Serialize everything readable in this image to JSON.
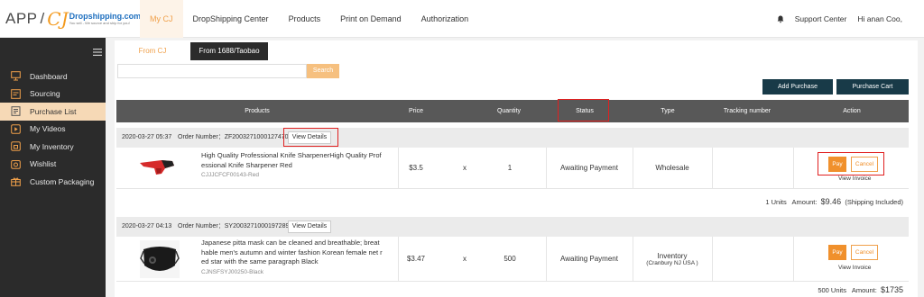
{
  "logo": {
    "app": "APP",
    "slash": "/",
    "cj": "CJ",
    "brand": "Dropshipping.com",
    "tagline": "You sell - We source and ship for you!"
  },
  "nav": {
    "items": [
      "My CJ",
      "DropShipping Center",
      "Products",
      "Print on Demand",
      "Authorization"
    ],
    "active": "My CJ"
  },
  "header_right": {
    "support": "Support Center",
    "greeting": "Hi anan Coo,"
  },
  "sidebar": {
    "items": [
      {
        "label": "Dashboard",
        "icon": "dashboard-icon"
      },
      {
        "label": "Sourcing",
        "icon": "sourcing-icon"
      },
      {
        "label": "Purchase List",
        "icon": "purchase-list-icon",
        "active": true
      },
      {
        "label": "My Videos",
        "icon": "video-icon"
      },
      {
        "label": "My Inventory",
        "icon": "inventory-icon"
      },
      {
        "label": "Wishlist",
        "icon": "wishlist-icon"
      },
      {
        "label": "Custom Packaging",
        "icon": "gift-icon"
      }
    ]
  },
  "tabs": [
    "From CJ",
    "From 1688/Taobao"
  ],
  "search": {
    "placeholder": "",
    "button": "Search"
  },
  "actions": {
    "add_purchase": "Add Purchase",
    "purchase_cart": "Purchase Cart"
  },
  "table": {
    "columns": [
      "Products",
      "Price",
      "Quantity",
      "Status",
      "Type",
      "Tracking number",
      "Action"
    ]
  },
  "orders": [
    {
      "date": "2020-03-27 05:37",
      "order_number_label": "Order Number：",
      "order_number": "ZF2003271000127470",
      "view_details": "View Details",
      "product_line1": "High Quality Professional Knife SharpenerHigh Quality Prof",
      "product_line2": "essional Knife Sharpener Red",
      "sku": "CJJJCFCF00143-Red",
      "price": "$3.5",
      "times": "x",
      "quantity": "1",
      "status": "Awaiting Payment",
      "type": "Wholesale",
      "type_sub": "",
      "tracking": "",
      "pay": "Pay",
      "cancel": "Cancel",
      "view_invoice": "View Invoice",
      "summary_units": "1 Units",
      "summary_amount_label": "Amount:",
      "summary_amount": "$9.46",
      "summary_note": "(Shipping Included)"
    },
    {
      "date": "2020-03-27 04:13",
      "order_number_label": "Order Number：",
      "order_number": "SY2003271000197289",
      "view_details": "View Details",
      "product_line1": "Japanese pitta mask can be cleaned and breathable; breat",
      "product_line2": "hable men's autumn and winter fashion Korean female net r",
      "product_line3": "ed star with the same paragraph Black",
      "sku": "CJNSFSYJ00250-Black",
      "price": "$3.47",
      "times": "x",
      "quantity": "500",
      "status": "Awaiting Payment",
      "type": "Inventory",
      "type_sub": "(Cranbury NJ USA )",
      "tracking": "",
      "pay": "Pay",
      "cancel": "Cancel",
      "view_invoice": "View Invoice",
      "summary_units": "500 Units",
      "summary_amount_label": "Amount:",
      "summary_amount": "$1735",
      "summary_note": ""
    }
  ],
  "colors": {
    "accent": "#f0902c",
    "dark": "#2b2b2b",
    "header_row": "#585858",
    "highlight": "#e02020",
    "navy": "#183a48"
  }
}
